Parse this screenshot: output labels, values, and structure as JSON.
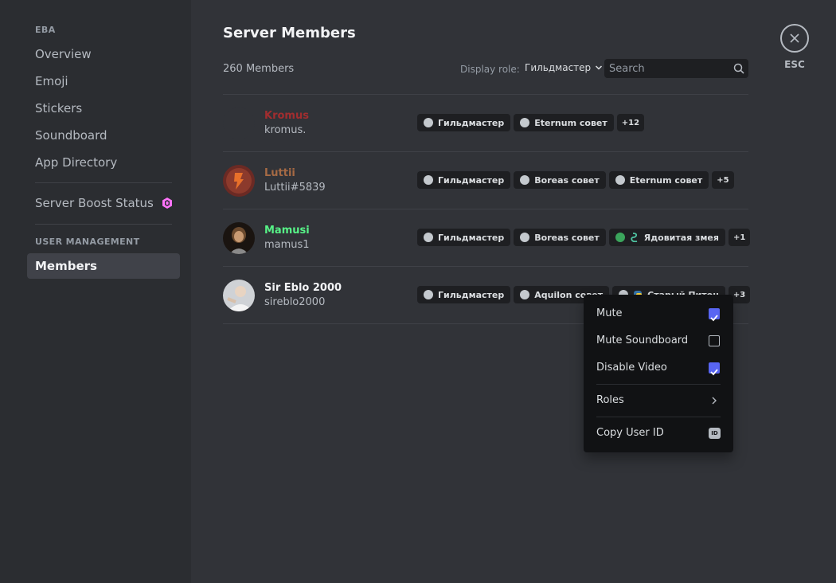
{
  "sidebar": {
    "server_heading": "EBA",
    "items": [
      {
        "label": "Overview"
      },
      {
        "label": "Emoji"
      },
      {
        "label": "Stickers"
      },
      {
        "label": "Soundboard"
      },
      {
        "label": "App Directory"
      }
    ],
    "boost_label": "Server Boost Status",
    "boost_icon": "nitro-boost-gem-icon",
    "user_mgmt_heading": "USER MANAGEMENT",
    "active_item": "Members",
    "accent": "#404249"
  },
  "header": {
    "title": "Server Members",
    "member_count": "260 Members",
    "display_role_label": "Display role:",
    "display_role_value": "Гильдмастер",
    "search_placeholder": "Search",
    "close_label": "ESC"
  },
  "members": [
    {
      "display_name": "Kromus",
      "username": "kromus.",
      "name_color": "#a12d2f",
      "roles": [
        {
          "label": "Гильдмастер",
          "dot": "gray"
        },
        {
          "label": "Eternum совет",
          "dot": "gray"
        }
      ],
      "more": "+12"
    },
    {
      "display_name": "Luttii",
      "username": "Luttii#5839",
      "name_color": "#a66a44",
      "roles": [
        {
          "label": "Гильдмастер",
          "dot": "gray"
        },
        {
          "label": "Boreas совет",
          "dot": "gray"
        },
        {
          "label": "Eternum совет",
          "dot": "gray"
        }
      ],
      "more": "+5"
    },
    {
      "display_name": "Mamusi",
      "username": "mamus1",
      "name_color": "#57f287",
      "roles": [
        {
          "label": "Гильдмастер",
          "dot": "gray"
        },
        {
          "label": "Boreas совет",
          "dot": "gray"
        },
        {
          "label": "Ядовитая змея",
          "dot": "green",
          "emoji": "snake-icon"
        }
      ],
      "more": "+1"
    },
    {
      "display_name": "Sir Eblo 2000",
      "username": "sireblo2000",
      "name_color": "#f2f3f5",
      "roles": [
        {
          "label": "Гильдмастер",
          "dot": "gray"
        },
        {
          "label": "Aquilon совет",
          "dot": "gray"
        },
        {
          "label": "Старый Питон",
          "dot": "gray",
          "emoji": "python-icon"
        }
      ],
      "more": "+3"
    }
  ],
  "context_menu": {
    "mute": {
      "label": "Mute",
      "checked": true
    },
    "mute_soundboard": {
      "label": "Mute Soundboard",
      "checked": false
    },
    "disable_video": {
      "label": "Disable Video",
      "checked": true
    },
    "roles": {
      "label": "Roles"
    },
    "copy_id": {
      "label": "Copy User ID",
      "badge": "ID"
    }
  }
}
